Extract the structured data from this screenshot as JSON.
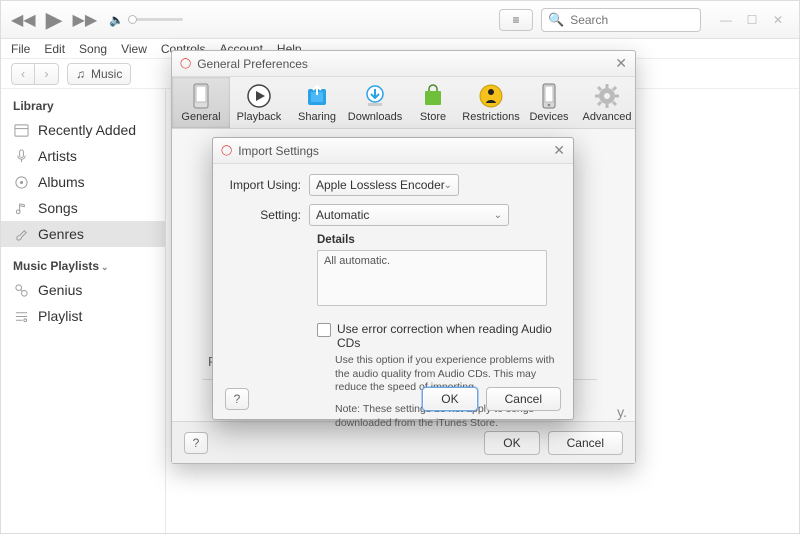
{
  "search": {
    "placeholder": "Search"
  },
  "menu": {
    "file": "File",
    "edit": "Edit",
    "song": "Song",
    "view": "View",
    "controls": "Controls",
    "account": "Account",
    "help": "Help"
  },
  "nav": {
    "music": "Music"
  },
  "sidebar": {
    "library_header": "Library",
    "items": [
      {
        "label": "Recently Added"
      },
      {
        "label": "Artists"
      },
      {
        "label": "Albums"
      },
      {
        "label": "Songs"
      },
      {
        "label": "Genres"
      }
    ],
    "playlists_header": "Music Playlists",
    "playlists": [
      {
        "label": "Genius"
      },
      {
        "label": "Playlist"
      }
    ]
  },
  "prefs": {
    "title": "General Preferences",
    "tabs": {
      "general": "General",
      "playback": "Playback",
      "sharing": "Sharing",
      "downloads": "Downloads",
      "store": "Store",
      "restrictions": "Restrictions",
      "devices": "Devices",
      "advanced": "Advanced"
    },
    "faded_label": "Pla",
    "faded_trail": "y.",
    "help": "?",
    "ok": "OK",
    "cancel": "Cancel"
  },
  "import": {
    "title": "Import Settings",
    "import_using_label": "Import Using:",
    "import_using_value": "Apple Lossless Encoder",
    "setting_label": "Setting:",
    "setting_value": "Automatic",
    "details_label": "Details",
    "details_value": "All automatic.",
    "error_correction": "Use error correction when reading Audio CDs",
    "error_hint": "Use this option if you experience problems with the audio quality from Audio CDs.  This may reduce the speed of importing.",
    "note": "Note: These settings do not apply to songs downloaded from the iTunes Store.",
    "help": "?",
    "ok": "OK",
    "cancel": "Cancel"
  }
}
